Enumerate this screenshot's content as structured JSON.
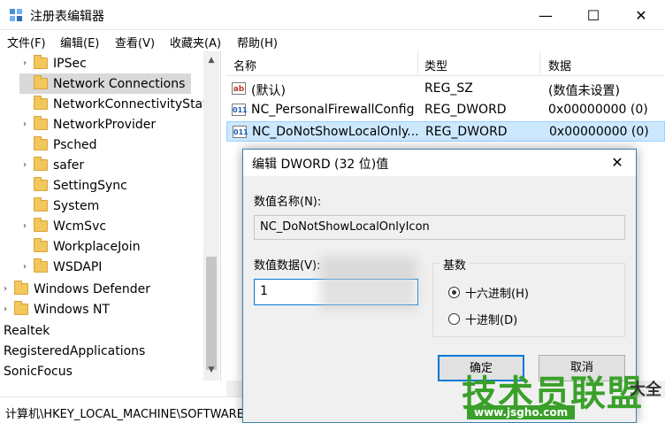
{
  "window": {
    "title": "注册表编辑器",
    "min_glyph": "—",
    "max_glyph": "☐",
    "close_glyph": "✕"
  },
  "menu": [
    "文件(F)",
    "编辑(E)",
    "查看(V)",
    "收藏夹(A)",
    "帮助(H)"
  ],
  "tree": {
    "items": [
      {
        "label": "IPSec",
        "expander": "›"
      },
      {
        "label": "Network Connections",
        "expander": "",
        "selected": true
      },
      {
        "label": "NetworkConnectivityStat",
        "expander": ""
      },
      {
        "label": "NetworkProvider",
        "expander": "›"
      },
      {
        "label": "Psched",
        "expander": ""
      },
      {
        "label": "safer",
        "expander": "›"
      },
      {
        "label": "SettingSync",
        "expander": ""
      },
      {
        "label": "System",
        "expander": ""
      },
      {
        "label": "WcmSvc",
        "expander": "›"
      },
      {
        "label": "WorkplaceJoin",
        "expander": ""
      },
      {
        "label": "WSDAPI",
        "expander": "›"
      },
      {
        "label": "Windows Defender",
        "expander": "›"
      },
      {
        "label": "Windows NT",
        "expander": "›"
      },
      {
        "label": "Realtek",
        "expander": ""
      },
      {
        "label": "RegisteredApplications",
        "expander": ""
      },
      {
        "label": "SonicFocus",
        "expander": ""
      }
    ],
    "scroll_up": "▲",
    "scroll_down": "▼"
  },
  "list": {
    "columns": [
      "名称",
      "类型",
      "数据"
    ],
    "rows": [
      {
        "icon": "ab",
        "name": "(默认)",
        "type": "REG_SZ",
        "data": "(数值未设置)"
      },
      {
        "icon": "011",
        "name": "NC_PersonalFirewallConfig",
        "type": "REG_DWORD",
        "data": "0x00000000 (0)"
      },
      {
        "icon": "011",
        "name": "NC_DoNotShowLocalOnly...",
        "type": "REG_DWORD",
        "data": "0x00000000 (0)",
        "selected": true
      }
    ]
  },
  "status": {
    "path": "计算机\\HKEY_LOCAL_MACHINE\\SOFTWARE\\Policies\\Microsoft\\Windows\\Netw"
  },
  "dialog": {
    "title": "编辑 DWORD (32 位)值",
    "close_glyph": "✕",
    "name_label": "数值名称(N):",
    "name_value": "NC_DoNotShowLocalOnlyIcon",
    "data_label": "数值数据(V):",
    "data_value": "1",
    "base_label": "基数",
    "radio_hex": "十六进制(H)",
    "radio_dec": "十进制(D)",
    "ok_label": "确定",
    "cancel_label": "取消"
  },
  "watermark": {
    "main": "技术员联盟",
    "url": "www.jsgho.com",
    "extra": "大全"
  }
}
